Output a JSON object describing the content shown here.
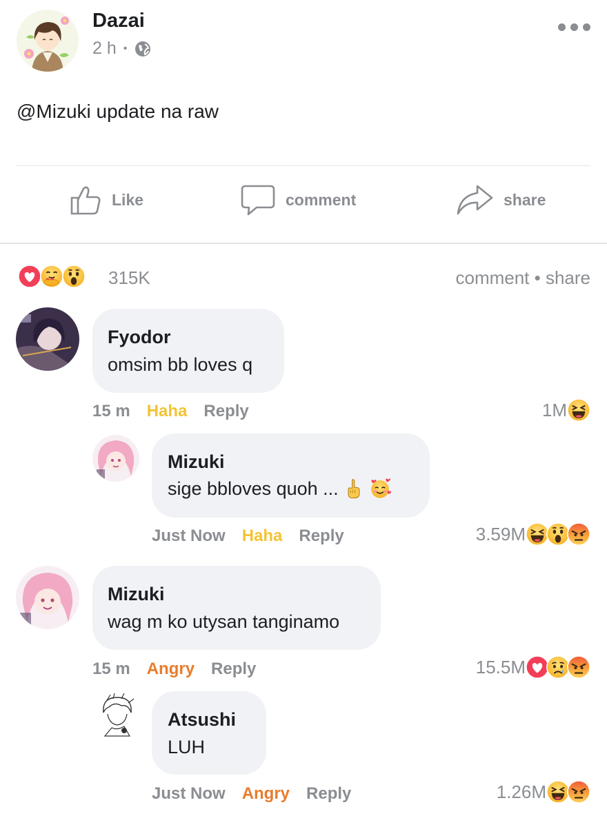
{
  "post": {
    "author": "Dazai",
    "time": "2 h",
    "separator": "•",
    "text": "@Mizuki update na raw"
  },
  "actions": {
    "like": "Like",
    "comment": "comment",
    "share": "share"
  },
  "summary": {
    "reactions": [
      "love",
      "care",
      "wow"
    ],
    "count": "315K",
    "links": "comment • share"
  },
  "comments": [
    {
      "author": "Fyodor",
      "text": "omsim bb loves q",
      "time": "15 m",
      "reaction_label": "Haha",
      "reply": "Reply",
      "count": "1M",
      "reactions": [
        "haha"
      ]
    },
    {
      "author": "Mizuki",
      "text": "sige bbloves quoh ...",
      "text_emoji": [
        "point-up",
        "smiling-hearts"
      ],
      "time": "Just Now",
      "reaction_label": "Haha",
      "reply": "Reply",
      "count": "3.59M",
      "reactions": [
        "haha",
        "wow",
        "angry"
      ]
    },
    {
      "author": "Mizuki",
      "text": "wag m ko utysan tanginamo",
      "time": "15 m",
      "reaction_label": "Angry",
      "reply": "Reply",
      "count": "15.5M",
      "reactions": [
        "love",
        "sad",
        "angry"
      ]
    },
    {
      "author": "Atsushi",
      "text": "LUH",
      "time": "Just Now",
      "reaction_label": "Angry",
      "reply": "Reply",
      "count": "1.26M",
      "reactions": [
        "haha",
        "angry"
      ]
    }
  ],
  "colors": {
    "haha_label": "#f3c334",
    "angry_label": "#e87c2c",
    "muted": "#8a8d91",
    "bubble": "#f0f2f5"
  }
}
